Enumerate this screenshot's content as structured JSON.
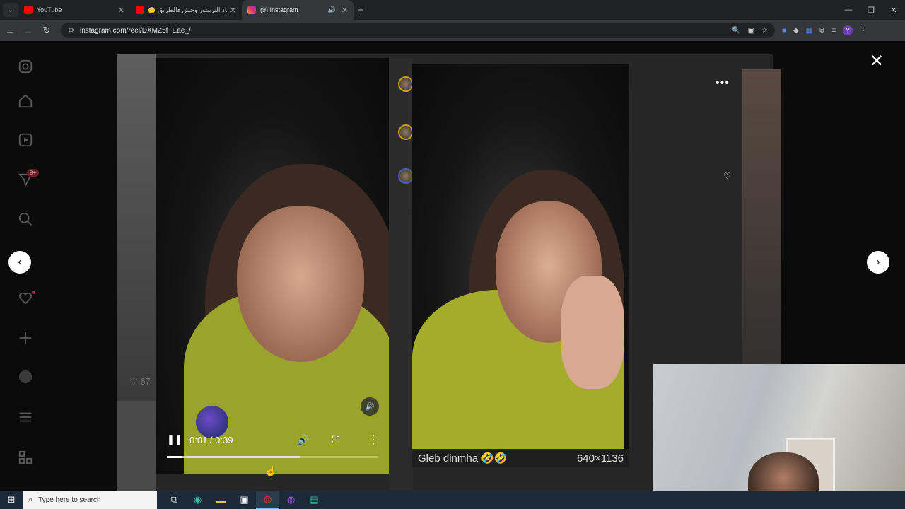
{
  "browser": {
    "tabs": [
      {
        "title": "YouTube",
        "favicon": "youtube-icon",
        "active": false
      },
      {
        "title": "هاد التريبتور وحش فالطريق",
        "favicon": "youtube-icon",
        "active": false
      },
      {
        "title": "(9) Instagram",
        "favicon": "instagram-icon",
        "active": true
      }
    ],
    "url": "instagram.com/reel/DXMZ5fTEae_/"
  },
  "sidebar": {
    "notifications_badge": "9+"
  },
  "reel": {
    "time": "0:01 / 0:39",
    "progress_played": 0.07,
    "progress_buffered": 0.63,
    "likes_partial": "67"
  },
  "popup": {
    "caption": "Gleb dinmha 🤣🤣",
    "resolution": "640×1136"
  },
  "taskbar": {
    "search_placeholder": "Type here to search"
  },
  "colors": {
    "tab_bg": "#202124",
    "active_tab": "#35363a",
    "taskbar": "#1c2a3a"
  }
}
